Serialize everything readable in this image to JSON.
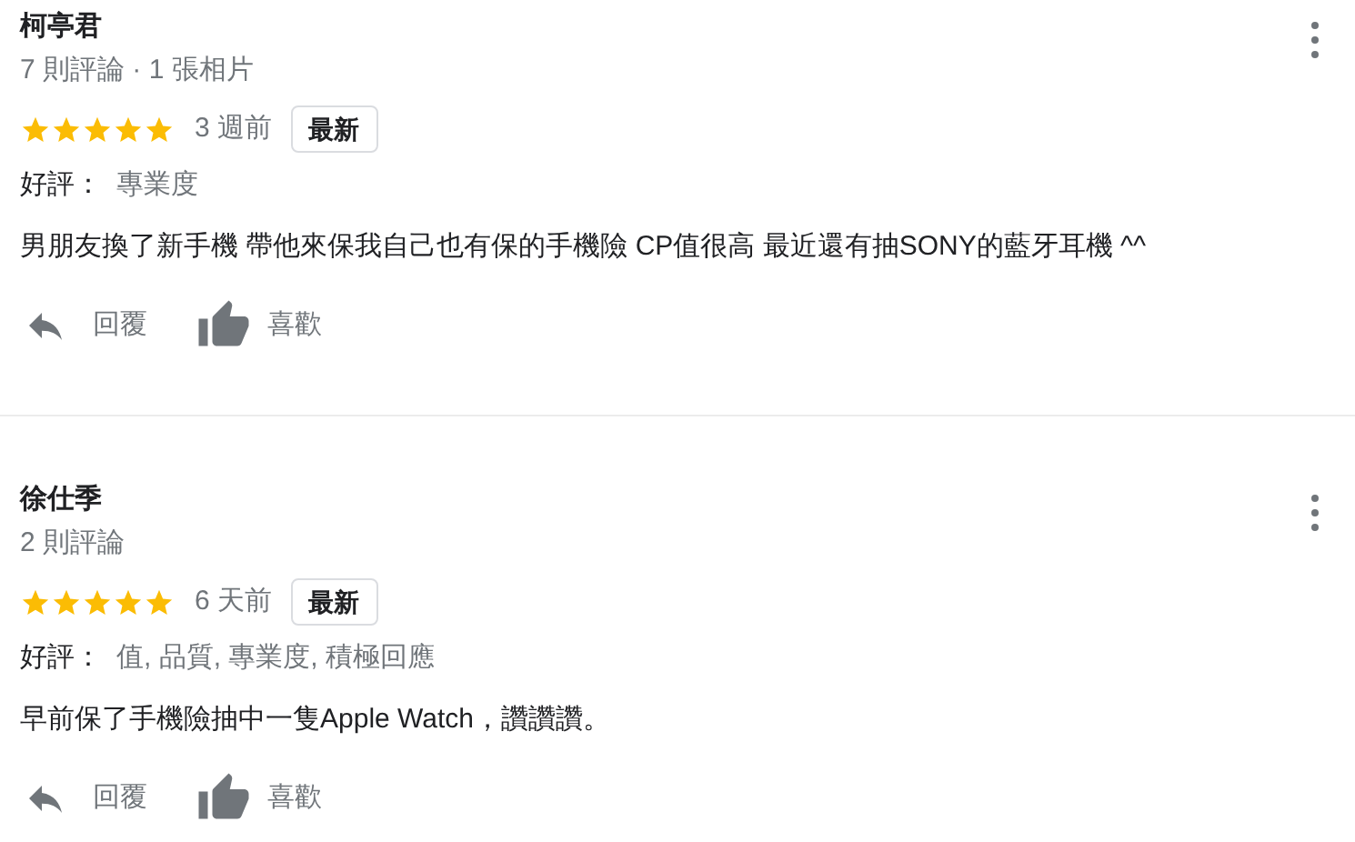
{
  "reviews": [
    {
      "name": "柯亭君",
      "meta": "7 則評論 · 1 張相片",
      "stars": 5,
      "time": "3 週前",
      "badge": "最新",
      "praise_label": "好評：",
      "praise": "專業度",
      "text": "男朋友換了新手機 帶他來保我自己也有保的手機險 CP值很高 最近還有抽SONY的藍牙耳機 ^^",
      "reply": "回覆",
      "like": "喜歡"
    },
    {
      "name": "徐仕季",
      "meta": "2 則評論",
      "stars": 5,
      "time": "6 天前",
      "badge": "最新",
      "praise_label": "好評：",
      "praise": "值, 品質, 專業度, 積極回應",
      "text": "早前保了手機險抽中一隻Apple Watch，讚讚讚。",
      "reply": "回覆",
      "like": "喜歡"
    }
  ]
}
